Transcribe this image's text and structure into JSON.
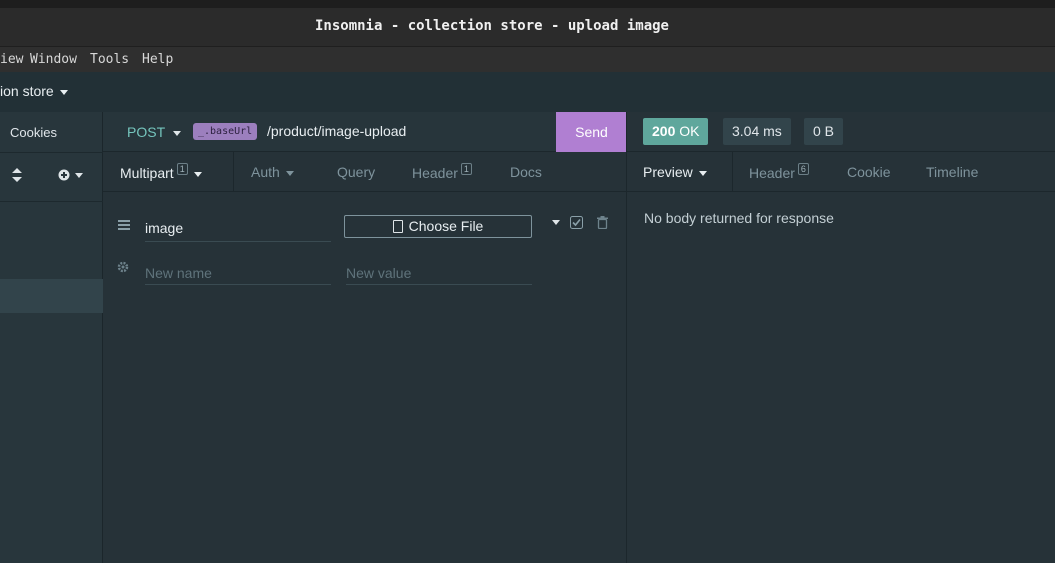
{
  "window": {
    "title": "Insomnia - collection store - upload image"
  },
  "menubar": {
    "items": [
      "iew",
      "Window",
      "Tools",
      "Help"
    ]
  },
  "workspace": {
    "name": "ion store"
  },
  "sidebar": {
    "cookies_label": "Cookies",
    "sort_icon": "sort-icon",
    "add_icon": "plus-circle-icon"
  },
  "request": {
    "method": "POST",
    "base_url_tag": "_.baseUrl",
    "path": "/product/image-upload",
    "send_label": "Send"
  },
  "request_tabs": {
    "body": {
      "label": "Multipart",
      "count": "1"
    },
    "auth": {
      "label": "Auth"
    },
    "query": {
      "label": "Query"
    },
    "header": {
      "label": "Header",
      "count": "1"
    },
    "docs": {
      "label": "Docs"
    }
  },
  "params": {
    "row1": {
      "name": "image",
      "file_button": "Choose File"
    },
    "new_row": {
      "name_placeholder": "New name",
      "value_placeholder": "New value"
    }
  },
  "response": {
    "status_code": "200",
    "status_text": "OK",
    "time": "3.04 ms",
    "size": "0 B",
    "empty_message": "No body returned for response"
  },
  "response_tabs": {
    "preview": {
      "label": "Preview"
    },
    "header": {
      "label": "Header",
      "count": "6"
    },
    "cookie": {
      "label": "Cookie"
    },
    "timeline": {
      "label": "Timeline"
    }
  },
  "colors": {
    "accent": "#b07fd2",
    "status_ok": "#5fa79c",
    "method": "#75c5bd",
    "base_url_tag": "#9c7fbe"
  }
}
